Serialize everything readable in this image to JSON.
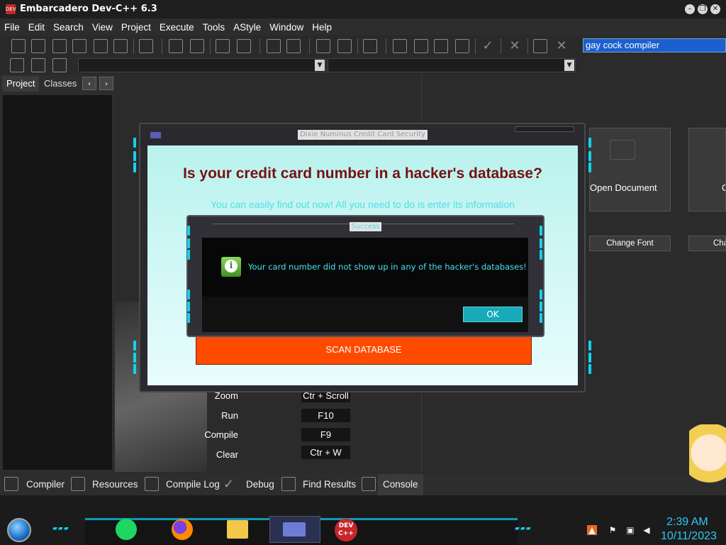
{
  "window": {
    "title": "Embarcadero Dev-C++ 6.3",
    "app_icon_text": "DEV"
  },
  "menu": [
    "File",
    "Edit",
    "Search",
    "View",
    "Project",
    "Execute",
    "Tools",
    "AStyle",
    "Window",
    "Help"
  ],
  "search": {
    "value": "gay cock compiler"
  },
  "left_panel": {
    "tabs": [
      "Project",
      "Classes"
    ],
    "prev": "‹",
    "next": "›"
  },
  "editor": {
    "tiles": [
      {
        "label": "Open Document"
      },
      {
        "label": "C"
      }
    ],
    "buttons": [
      {
        "label": "Change Font"
      },
      {
        "label": "Cha"
      }
    ],
    "shortcuts": [
      {
        "label": "Zoom",
        "key": "Ctr + Scroll"
      },
      {
        "label": "Run",
        "key": "F10"
      },
      {
        "label": "Compile",
        "key": "F9"
      },
      {
        "label": "Clear",
        "key": "Ctr + W"
      }
    ]
  },
  "bottom_tabs": [
    "Compiler",
    "Resources",
    "Compile Log",
    "Debug",
    "Find Results",
    "Console"
  ],
  "scam_window": {
    "title": "Dixie Numinus Credit Card Security",
    "headline": "Is your credit card number in a hacker's database?",
    "subtitle": "You can easily find out now! All you need to do is enter its information",
    "scan_button": "SCAN DATABASE"
  },
  "success_dialog": {
    "title": "Success",
    "message": "Your card number did not show up in any of the hacker's databases!",
    "ok_label": "OK",
    "icon": "info-icon"
  },
  "taskbar": {
    "clock_time": "2:39 AM",
    "clock_date": "10/11/2023",
    "apps": [
      "spotify-icon",
      "firefox-icon",
      "file-explorer-icon",
      "window-icon",
      "devcpp-icon"
    ],
    "devcpp_icon_text": "DEV C++"
  },
  "colors": {
    "accent_cyan": "#11d3ee",
    "scan_orange": "#ff4b00",
    "headline": "#7a1010"
  }
}
